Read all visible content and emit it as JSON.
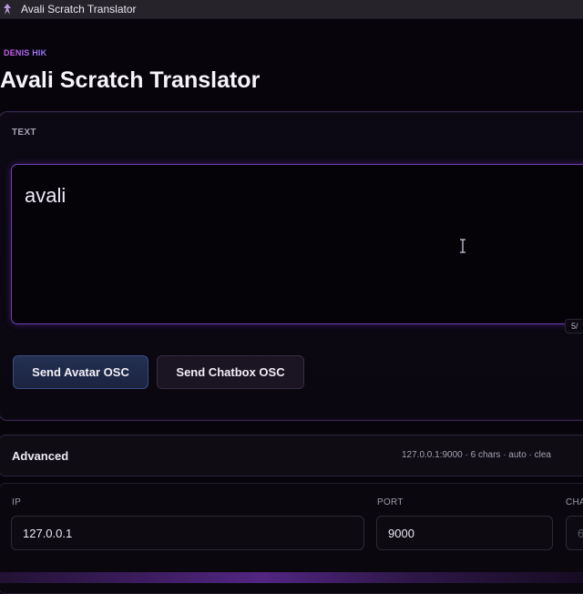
{
  "window": {
    "title": "Avali Scratch Translator"
  },
  "header": {
    "brand": "DENIS HIK",
    "title": "Avali Scratch Translator"
  },
  "text_section": {
    "label": "TEXT",
    "value": "avali",
    "char_count": "5/"
  },
  "buttons": {
    "send_avatar": "Send Avatar OSC",
    "send_chatbox": "Send Chatbox OSC"
  },
  "advanced": {
    "title": "Advanced",
    "summary": "127.0.0.1:9000 · 6 chars · auto · clea"
  },
  "settings": {
    "ip_label": "IP",
    "ip_value": "127.0.0.1",
    "port_label": "PORT",
    "port_value": "9000",
    "chars_label": "CHA",
    "chars_value": "6"
  },
  "colors": {
    "accent": "#6b3fb4",
    "background": "#07050b",
    "avatar_button": "#243052",
    "chatbox_button": "#1b1422"
  },
  "icons": {
    "app": "avali-app-icon",
    "cursor": "text-cursor-icon"
  }
}
